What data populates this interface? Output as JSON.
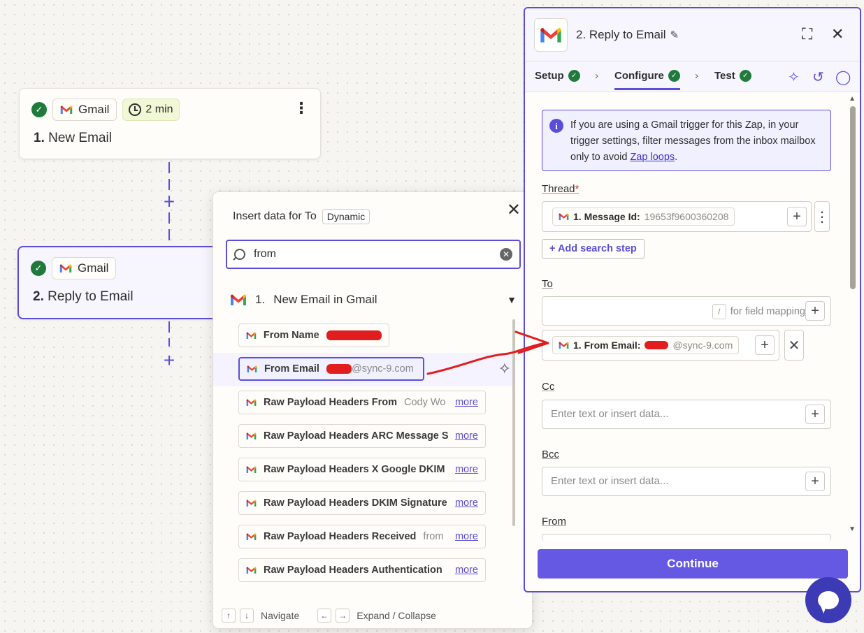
{
  "canvas": {
    "node1": {
      "app": "Gmail",
      "time": "2 min",
      "step_num": "1.",
      "step_name": "New Email"
    },
    "node2": {
      "app": "Gmail",
      "step_num": "2.",
      "step_name": "Reply to Email"
    },
    "plus": "+"
  },
  "popover": {
    "title": "Insert data for To",
    "badge": "Dynamic",
    "close": "✕",
    "search_value": "from",
    "group": {
      "num": "1.",
      "name": "New Email in Gmail"
    },
    "items": [
      {
        "label": "From Name",
        "value": "",
        "more": ""
      },
      {
        "label": "From Email",
        "value": "@sync-9.com",
        "more": ""
      },
      {
        "label": "Raw Payload Headers From",
        "value": "Cody Wo",
        "more": "more"
      },
      {
        "label": "Raw Payload Headers ARC Message S",
        "value": "",
        "more": "more"
      },
      {
        "label": "Raw Payload Headers X Google DKIM",
        "value": "",
        "more": "more"
      },
      {
        "label": "Raw Payload Headers DKIM Signature",
        "value": "",
        "more": "more"
      },
      {
        "label": "Raw Payload Headers Received",
        "value": "from",
        "more": "more"
      },
      {
        "label": "Raw Payload Headers Authentication",
        "value": "",
        "more": "more"
      }
    ],
    "footer": {
      "navigate": "Navigate",
      "expand": "Expand / Collapse",
      "up": "↑",
      "down": "↓",
      "left": "←",
      "right": "→"
    }
  },
  "panel": {
    "title": "2. Reply to Email",
    "tabs": [
      {
        "label": "Setup"
      },
      {
        "label": "Configure"
      },
      {
        "label": "Test"
      }
    ],
    "info": {
      "text": "If you are using a Gmail trigger for this Zap, in your trigger settings, filter messages from the inbox mailbox only to avoid ",
      "link": "Zap loops",
      "tail": "."
    },
    "thread": {
      "label": "Thread",
      "required": "*",
      "chip_label": "1. Message Id:",
      "chip_value": "19653f9600360208"
    },
    "add_search_step": "+ Add search step",
    "to": {
      "label": "To",
      "slash": "/",
      "hint": "for field mapping",
      "chip_label": "1. From Email:",
      "chip_value": "@sync-9.com"
    },
    "cc": {
      "label": "Cc",
      "placeholder": "Enter text or insert data..."
    },
    "bcc": {
      "label": "Bcc",
      "placeholder": "Enter text or insert data..."
    },
    "from": {
      "label": "From"
    },
    "continue": "Continue"
  },
  "colors": {
    "accent": "#5a4ed8",
    "success": "#1f7a3c",
    "annotation": "#e11d1d"
  }
}
